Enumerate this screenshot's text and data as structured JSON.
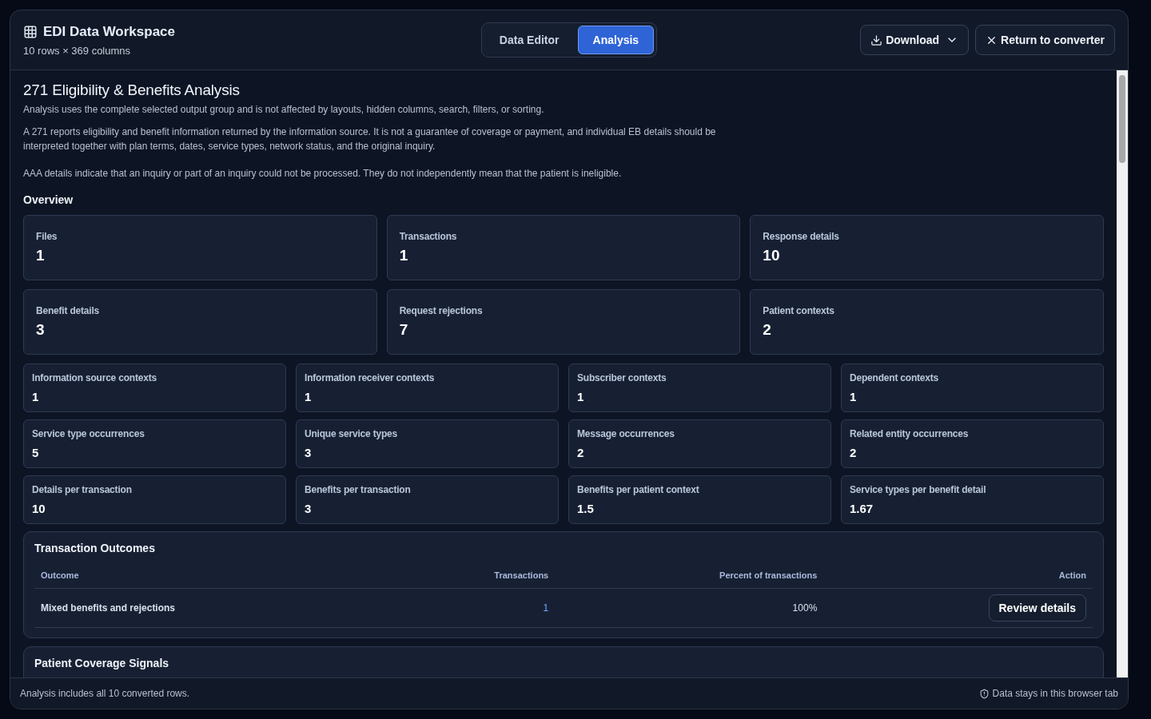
{
  "header": {
    "title": "EDI Data Workspace",
    "subtitle": "10 rows × 369 columns"
  },
  "tabs": [
    {
      "label": "Data Editor",
      "selected": false
    },
    {
      "label": "Analysis",
      "selected": true
    }
  ],
  "actions": [
    {
      "kind": "download",
      "label": "Download"
    },
    {
      "kind": "close",
      "label": "Return to converter"
    }
  ],
  "analysis": {
    "title": "271 Eligibility & Benefits Analysis",
    "note": "Analysis uses the complete selected output group and is not affected by layouts, hidden columns, search, filters, or sorting.",
    "paragraphs": [
      "A 271 reports eligibility and benefit information returned by the information source. It is not a guarantee of coverage or payment, and individual EB details should be interpreted together with plan terms, dates, service types, network status, and the original inquiry.",
      "AAA details indicate that an inquiry or part of an inquiry could not be processed. They do not independently mean that the patient is ineligible."
    ],
    "overview_title": "Overview",
    "primary_stats": [
      {
        "label": "Files",
        "value": "1"
      },
      {
        "label": "Transactions",
        "value": "1"
      },
      {
        "label": "Response details",
        "value": "10"
      },
      {
        "label": "Benefit details",
        "value": "3"
      },
      {
        "label": "Request rejections",
        "value": "7"
      },
      {
        "label": "Patient contexts",
        "value": "2"
      }
    ],
    "secondary_stats": [
      {
        "label": "Information source contexts",
        "value": "1"
      },
      {
        "label": "Information receiver contexts",
        "value": "1"
      },
      {
        "label": "Subscriber contexts",
        "value": "1"
      },
      {
        "label": "Dependent contexts",
        "value": "1"
      },
      {
        "label": "Service type occurrences",
        "value": "5"
      },
      {
        "label": "Unique service types",
        "value": "3"
      },
      {
        "label": "Message occurrences",
        "value": "2"
      },
      {
        "label": "Related entity occurrences",
        "value": "2"
      },
      {
        "label": "Details per transaction",
        "value": "10"
      },
      {
        "label": "Benefits per transaction",
        "value": "3"
      },
      {
        "label": "Benefits per patient context",
        "value": "1.5"
      },
      {
        "label": "Service types per benefit detail",
        "value": "1.67"
      }
    ],
    "outcomes": {
      "title": "Transaction Outcomes",
      "columns": [
        "Outcome",
        "Transactions",
        "Percent of transactions",
        "Action"
      ],
      "rows": [
        {
          "outcome": "Mixed benefits and rejections",
          "transactions": "1",
          "percent": "100%",
          "action": "Review details"
        }
      ]
    },
    "next_section": {
      "title": "Patient Coverage Signals"
    }
  },
  "status_bar": {
    "left": "Analysis includes all 10 converted rows.",
    "right": "Data stays in this browser tab"
  }
}
